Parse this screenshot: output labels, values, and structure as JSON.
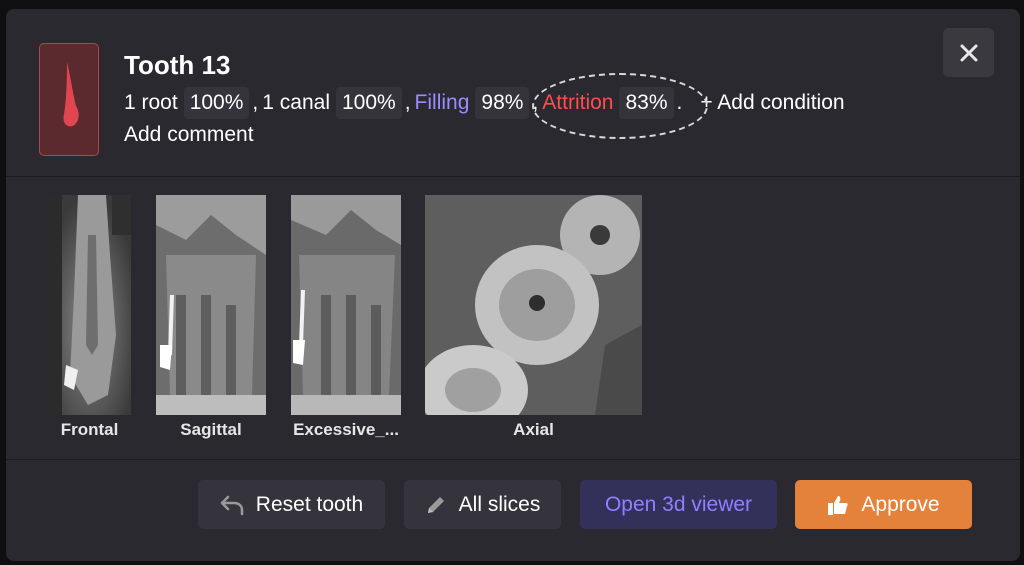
{
  "dialog": {
    "title": "Tooth 13",
    "add_comment": "Add comment"
  },
  "conditions": [
    {
      "label": "1 root",
      "percent": "100%",
      "color": "#ffffff"
    },
    {
      "label": "1 canal",
      "percent": "100%",
      "color": "#ffffff"
    },
    {
      "label": "Filling",
      "percent": "98%",
      "color": "#9b8cff"
    },
    {
      "label": "Attrition",
      "percent": "83%",
      "color": "#ff4d4d"
    }
  ],
  "separators": {
    "comma": ",",
    "period": "."
  },
  "add_condition": "+ Add condition",
  "slices": [
    {
      "label": "Frontal"
    },
    {
      "label": "Sagittal"
    },
    {
      "label": "Excessive_..."
    },
    {
      "label": "Axial"
    }
  ],
  "footer": {
    "reset_label": "Reset tooth",
    "all_slices_label": "All slices",
    "viewer_label": "Open 3d viewer",
    "approve_label": "Approve"
  },
  "icons": {
    "close": "close-icon",
    "tooth": "tooth-icon",
    "reset": "undo-icon",
    "all_slices": "pencil-icon",
    "approve": "thumbs-up-icon"
  },
  "colors": {
    "panel": "#2a2930",
    "accent_purple": "#8f80ff",
    "approve": "#e4823b",
    "attrition": "#ff4d4d",
    "filling": "#9b8cff"
  }
}
